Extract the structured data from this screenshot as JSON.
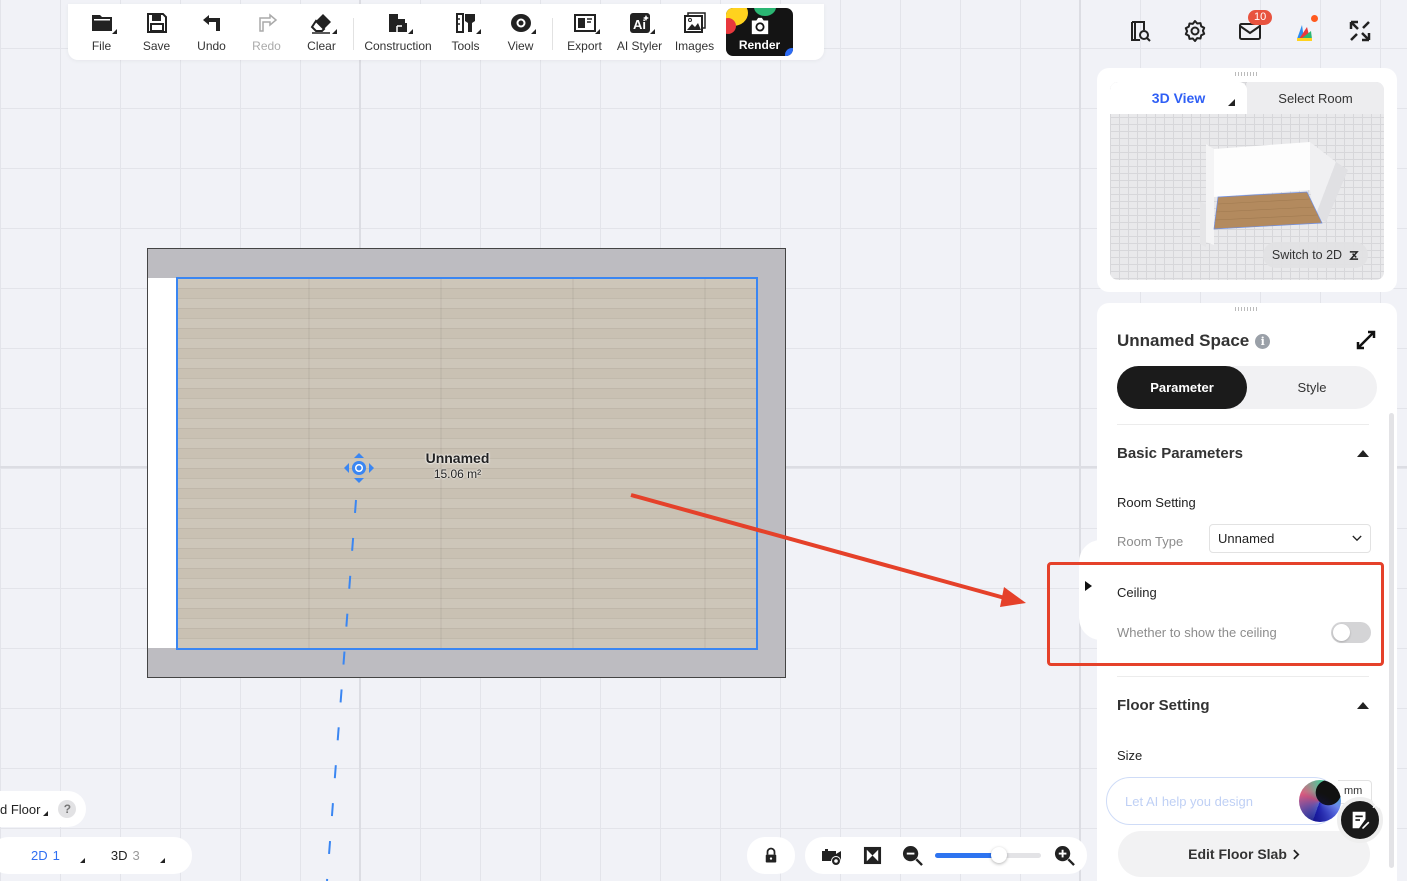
{
  "toolbar": {
    "items": [
      {
        "label": "File",
        "icon": "folder-icon"
      },
      {
        "label": "Save",
        "icon": "save-icon"
      },
      {
        "label": "Undo",
        "icon": "undo-icon"
      },
      {
        "label": "Redo",
        "icon": "redo-icon",
        "disabled": true
      },
      {
        "label": "Clear",
        "icon": "eraser-icon"
      },
      {
        "label": "Construction",
        "icon": "construction-icon"
      },
      {
        "label": "Tools",
        "icon": "tools-icon"
      },
      {
        "label": "View",
        "icon": "eye-icon"
      },
      {
        "label": "Export",
        "icon": "export-icon"
      },
      {
        "label": "AI Styler",
        "icon": "ai-styler-icon"
      },
      {
        "label": "Images",
        "icon": "images-icon"
      }
    ],
    "render_label": "Render"
  },
  "top_right": {
    "mail_badge": "10",
    "icons": [
      "search-catalog-icon",
      "settings-icon",
      "mail-icon",
      "color-palette-icon",
      "fullscreen-icon"
    ]
  },
  "canvas": {
    "room": {
      "name": "Unnamed",
      "area": "15.06 m²"
    },
    "colors": {
      "selection": "#3a86f2",
      "wall": "#bdbcc1",
      "annotation": "#e5412a"
    }
  },
  "preview_panel": {
    "tab_active": "3D View",
    "tab_other": "Select Room",
    "switch_label": "Switch to 2D"
  },
  "properties_panel": {
    "title": "Unnamed Space",
    "tabs": {
      "active": "Parameter",
      "other": "Style"
    },
    "basic_parameters": {
      "heading": "Basic Parameters",
      "room_setting_label": "Room Setting",
      "room_type_label": "Room Type",
      "room_type_value": "Unnamed"
    },
    "ceiling": {
      "heading": "Ceiling",
      "toggle_label": "Whether to show the ceiling",
      "toggle_on": false
    },
    "floor_setting": {
      "heading": "Floor Setting",
      "size_label": "Size",
      "unit": "mm",
      "edit_button": "Edit Floor Slab"
    },
    "ai_input_placeholder": "Let AI help you design"
  },
  "bottom_left": {
    "floor_label": "d Floor",
    "help": "?",
    "view_2d": "2D",
    "view_2d_count": "1",
    "view_3d": "3D",
    "view_3d_count": "3"
  },
  "bottom_controls": {
    "zoom_level_percent": 60
  }
}
